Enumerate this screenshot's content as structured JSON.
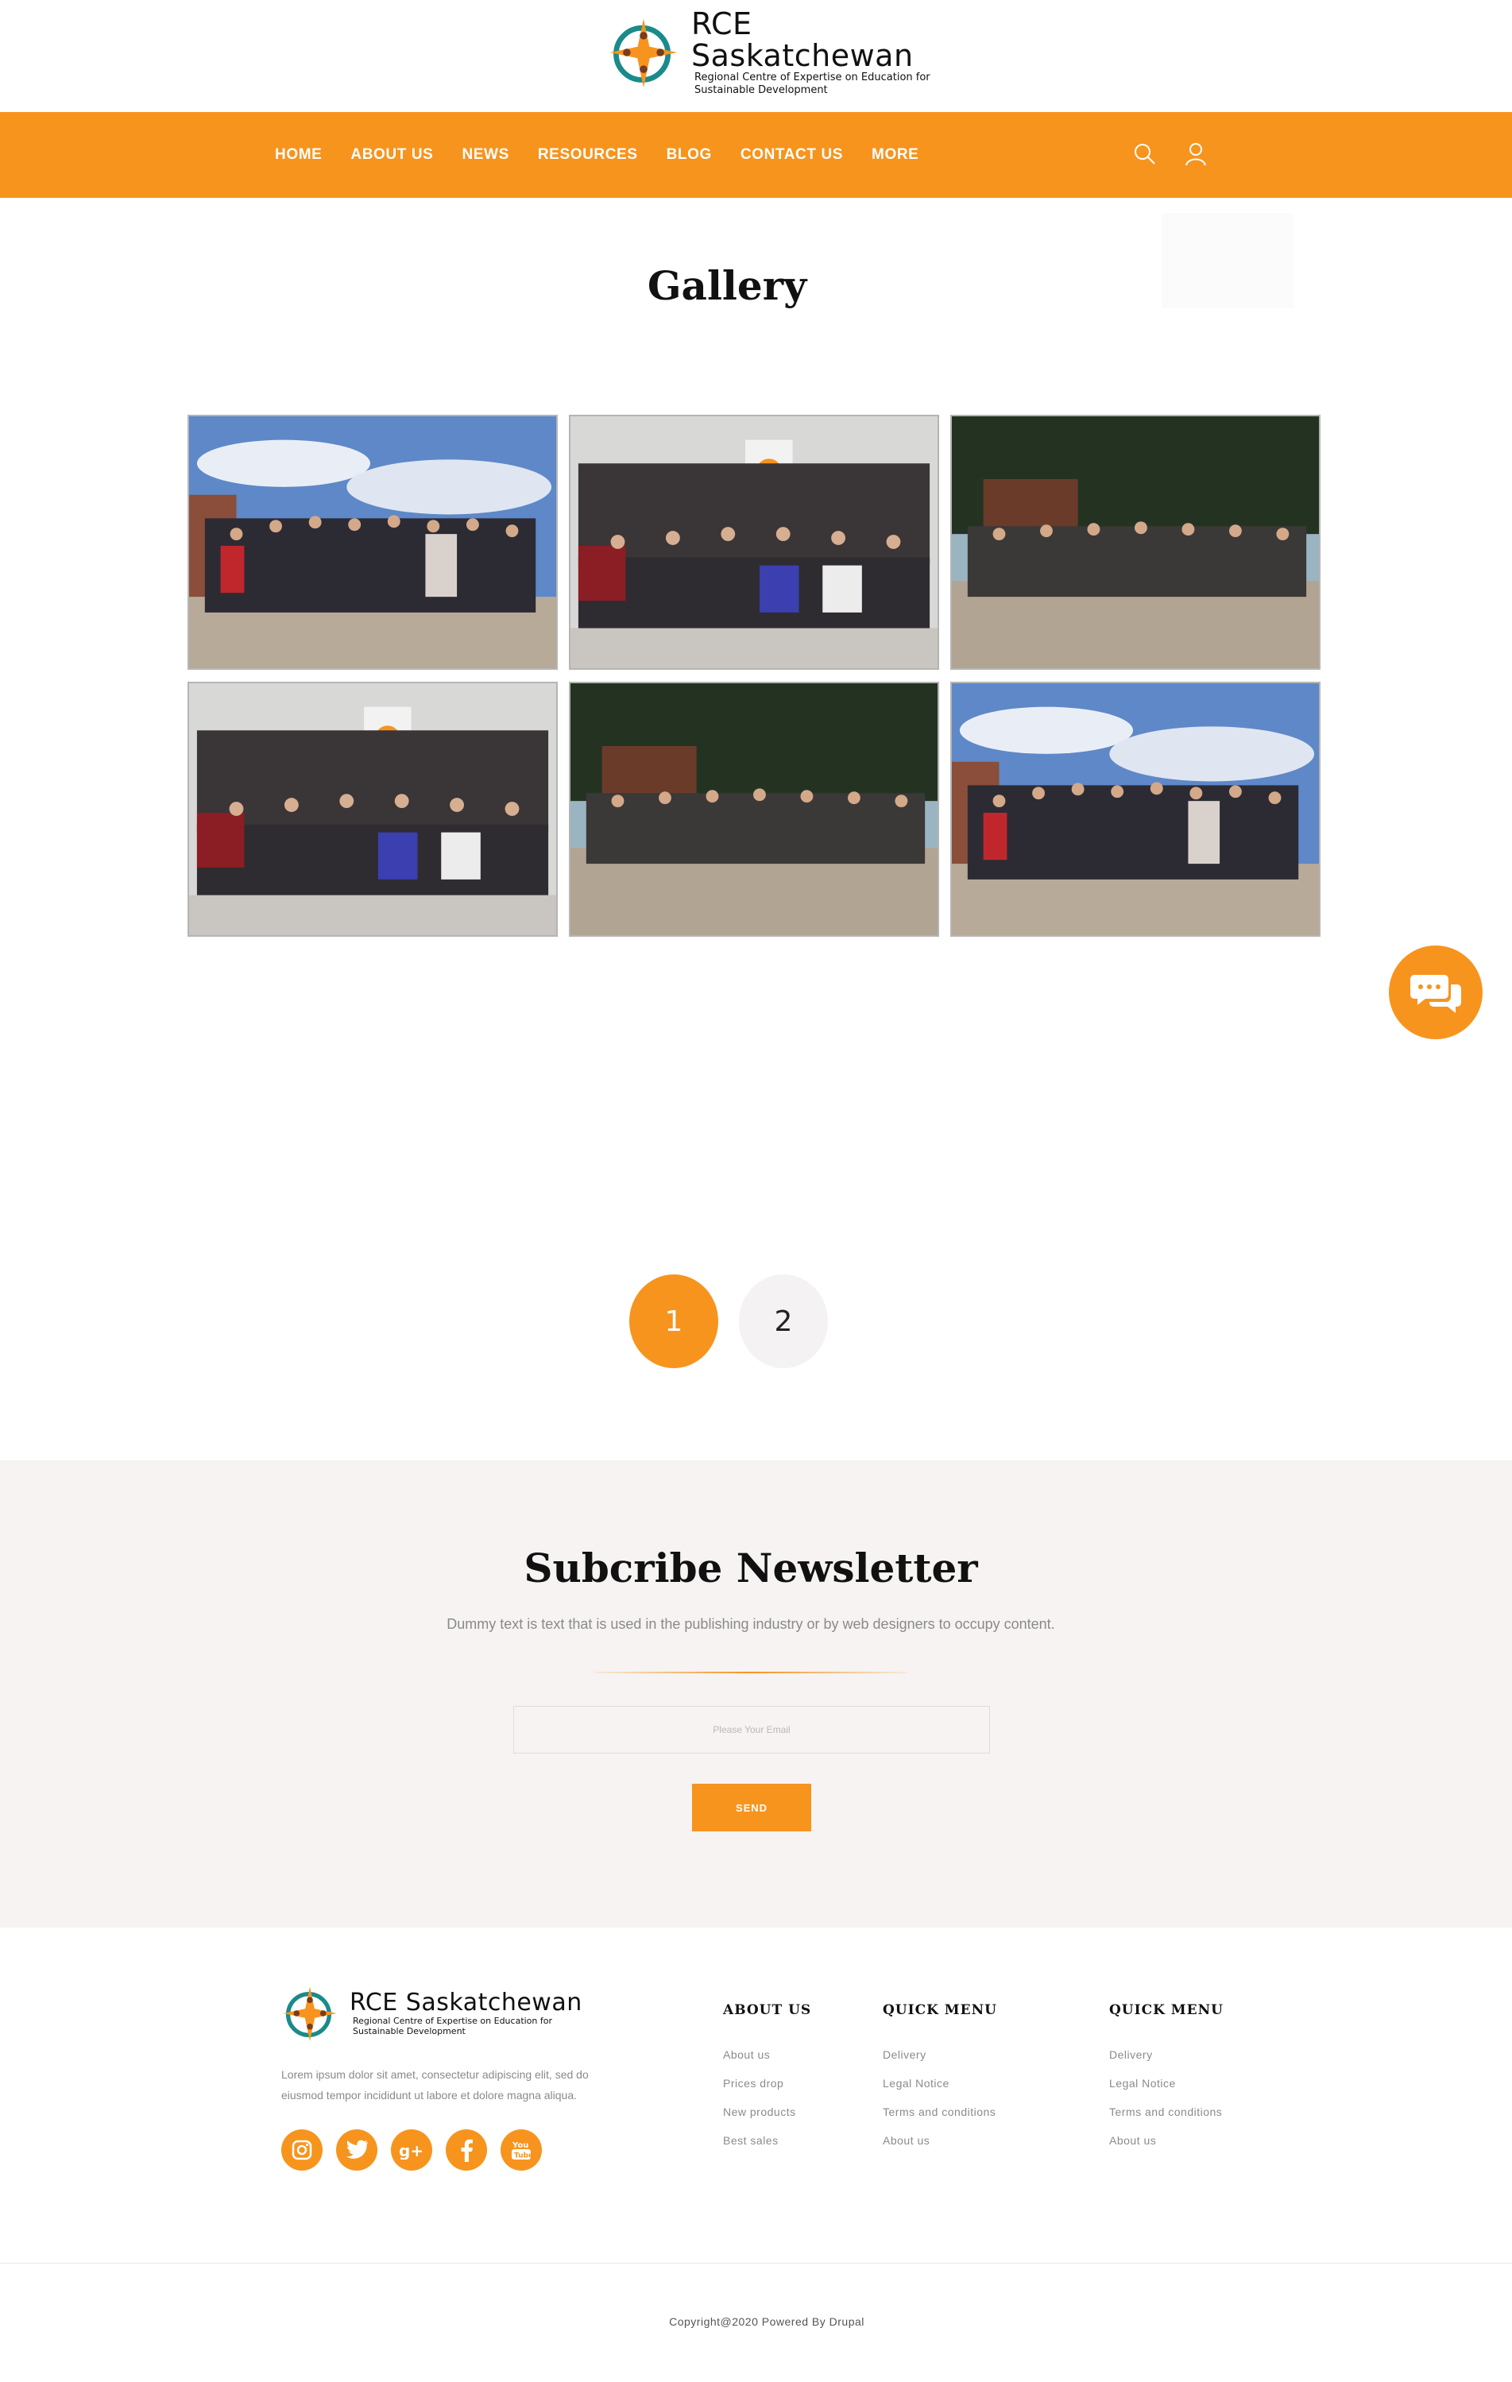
{
  "site": {
    "title": "RCE Saskatchewan",
    "subtitle": "Regional Centre of Expertise on Education for Sustainable Development",
    "accent_color": "#f7941e"
  },
  "nav": {
    "items": [
      {
        "label": "HOME"
      },
      {
        "label": "ABOUT US"
      },
      {
        "label": "NEWS"
      },
      {
        "label": "RESOURCES"
      },
      {
        "label": "BLOG"
      },
      {
        "label": "CONTACT US"
      },
      {
        "label": "MORE"
      }
    ],
    "icons": [
      "search-icon",
      "user-icon"
    ]
  },
  "page": {
    "title": "Gallery"
  },
  "gallery": {
    "items": [
      {
        "scene": "outdoor group photo with blue sky"
      },
      {
        "scene": "indoor group photo with banner"
      },
      {
        "scene": "outdoor group photo among trees"
      },
      {
        "scene": "indoor group photo with banner"
      },
      {
        "scene": "outdoor group photo among trees"
      },
      {
        "scene": "outdoor group photo with blue sky"
      }
    ]
  },
  "chat": {
    "icon": "chat-icon"
  },
  "pager": {
    "pages": [
      "1",
      "2"
    ],
    "current": "1"
  },
  "newsletter": {
    "title": "Subcribe Newsletter",
    "description": "Dummy text is text that is used in the publishing industry or by web designers to occupy content.",
    "placeholder": "Please Your Email",
    "button": "SEND"
  },
  "footer": {
    "about_text": "Lorem ipsum dolor sit amet, consectetur adipiscing elit, sed do eiusmod tempor incididunt ut labore et dolore magna aliqua.",
    "social_icons": [
      "instagram-icon",
      "twitter-icon",
      "google-plus-icon",
      "facebook-icon",
      "youtube-icon"
    ],
    "columns": [
      {
        "heading": "ABOUT US",
        "links": [
          "About us",
          "Prices drop",
          "New products",
          "Best sales"
        ]
      },
      {
        "heading": "QUICK MENU",
        "links": [
          "Delivery",
          "Legal Notice",
          "Terms and conditions",
          "About us"
        ]
      },
      {
        "heading": "QUICK MENU",
        "links": [
          "Delivery",
          "Legal Notice",
          "Terms and conditions",
          "About us"
        ]
      }
    ],
    "copyright": "Copyright@2020 Powered By Drupal"
  }
}
